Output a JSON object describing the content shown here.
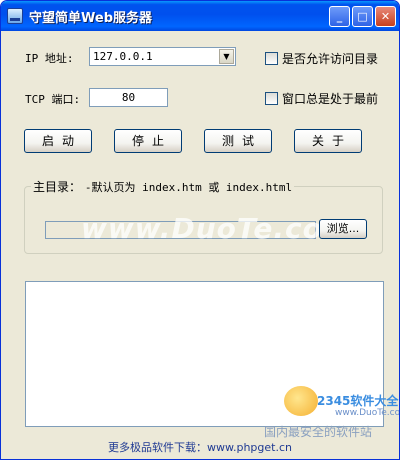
{
  "window": {
    "title": "守望简单Web服务器",
    "minimize_glyph": "_",
    "maximize_glyph": "□",
    "close_glyph": "✕"
  },
  "form": {
    "ip_label": "IP 地址:",
    "ip_value": "127.0.0.1",
    "port_label": "TCP 端口:",
    "port_value": "80",
    "allow_dir_label": "是否允许访问目录",
    "always_top_label": "窗口总是处于最前"
  },
  "buttons": {
    "start": "启动",
    "stop": "停止",
    "test": "测试",
    "about": "关于"
  },
  "home_dir": {
    "title_prefix": "主目录：",
    "title_hint": "-默认页为 index.htm 或 index.html",
    "path_value": "",
    "browse_label": "浏览..."
  },
  "footer": {
    "text": "更多极品软件下载：www.phpget.cn"
  },
  "watermark": {
    "main": "www.DuoTe.com",
    "logo_text": "2345软件大全",
    "logo_url": "www.DuoTe.com",
    "slogan": "国内最安全的软件站"
  },
  "colors": {
    "titlebar": "#0053ee",
    "window_bg": "#ece9d8",
    "border_blue": "#7f9db9"
  }
}
